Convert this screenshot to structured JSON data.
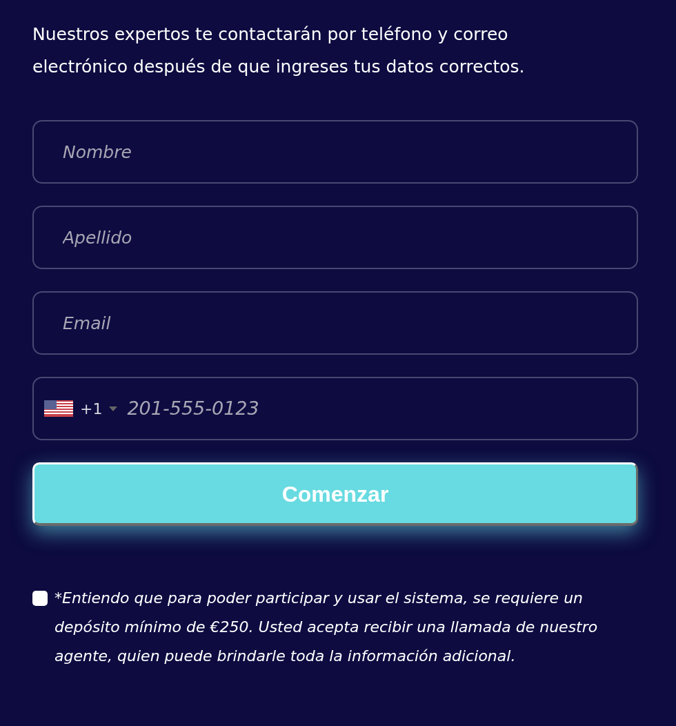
{
  "intro": "Nuestros expertos te contactarán por teléfono y correo electrónico después de que ingreses tus datos correctos.",
  "fields": [
    {
      "placeholder": "Nombre"
    },
    {
      "placeholder": "Apellido"
    },
    {
      "placeholder": "Email"
    }
  ],
  "phone": {
    "dial_code": "+1",
    "placeholder": "201-555-0123"
  },
  "submit": "Comenzar",
  "consent": {
    "checked": false,
    "text": "*Entiendo que para poder participar y usar el sistema, se requiere un depósito mínimo de €250. Usted acepta recibir una llamada de nuestro agente, quien puede brindarle toda la información adicional."
  }
}
